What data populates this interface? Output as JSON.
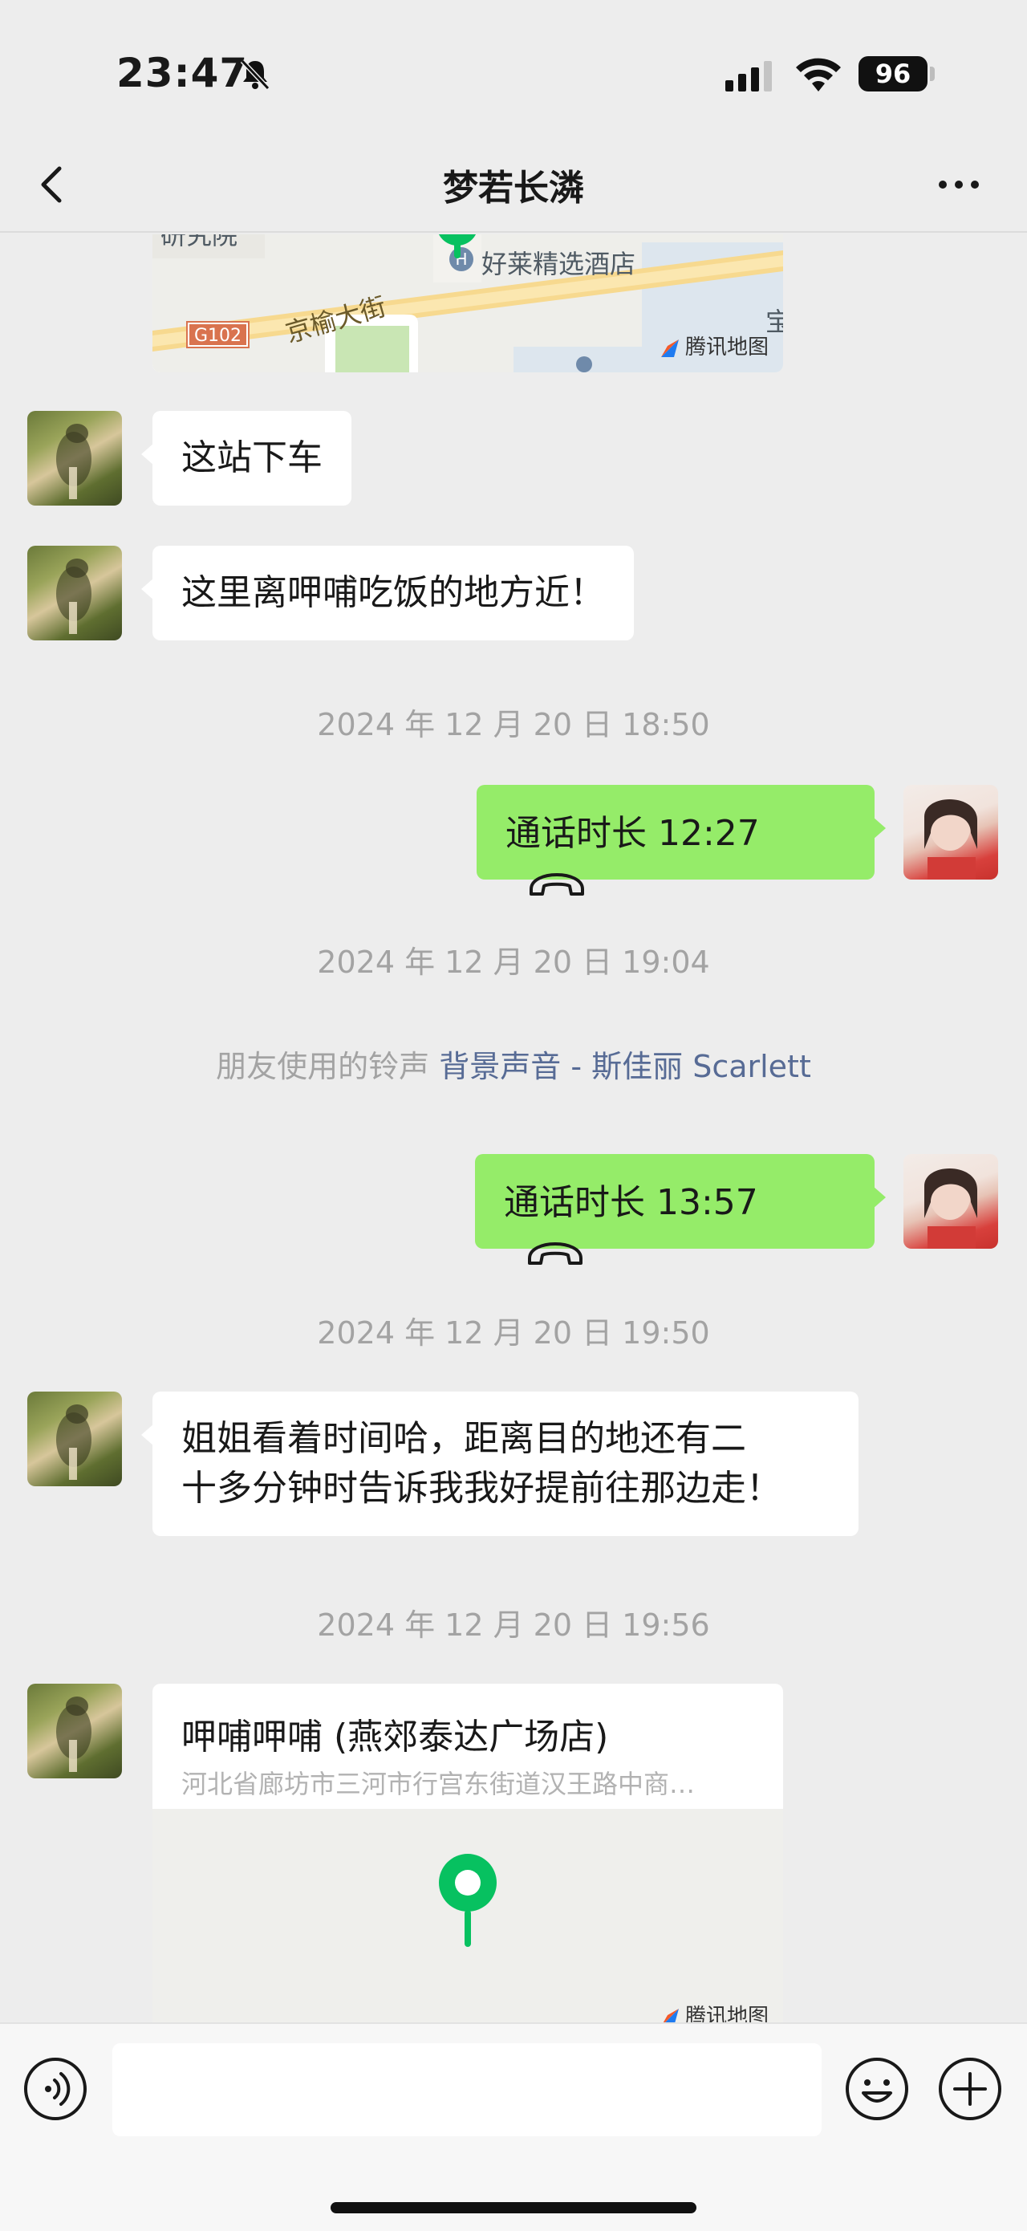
{
  "status_bar": {
    "time": "23:47",
    "battery": "96",
    "icons": [
      "bell-muted-icon",
      "signal-icon",
      "wifi-icon",
      "battery-icon"
    ]
  },
  "nav": {
    "title": "梦若长潾",
    "back_icon": "chevron-left-icon",
    "more_icon": "more-dots-icon"
  },
  "messages": {
    "map1": {
      "road": "京榆大街",
      "hotel": "好莱精选酒店",
      "top_fragment": "研究院",
      "right_fragment": "宝",
      "route_badge": "G102",
      "attribution": "腾讯地图"
    },
    "msg1": {
      "text": "这站下车"
    },
    "msg2": {
      "text": "这里离呷哺吃饭的地方近！"
    },
    "ts1": "2024 年 12 月 20 日 18:50",
    "call1": {
      "text": "通话时长 12:27"
    },
    "ts2": "2024 年 12 月 20 日 19:04",
    "system": {
      "prefix": "朋友使用的铃声",
      "link": "背景声音 - 斯佳丽 Scarlett"
    },
    "call2": {
      "text": "通话时长 13:57"
    },
    "ts3": "2024 年 12 月 20 日 19:50",
    "msg3": {
      "line1": "姐姐看着时间哈，距离目的地还有二",
      "line2": "十多分钟时告诉我我好提前往那边走！"
    },
    "ts4": "2024 年 12 月 20 日 19:56",
    "location": {
      "title": "呷哺呷哺 (燕郊泰达广场店)",
      "address": "河北省廊坊市三河市行宫东街道汉王路中商…",
      "attribution": "腾讯地图"
    }
  },
  "input_bar": {
    "placeholder": "",
    "icons": [
      "voice-icon",
      "emoji-icon",
      "plus-icon"
    ]
  },
  "colors": {
    "background": "#ededed",
    "bubble_self": "#95ec69",
    "bubble_other": "#ffffff",
    "link": "#576b95",
    "pin": "#07c160"
  }
}
